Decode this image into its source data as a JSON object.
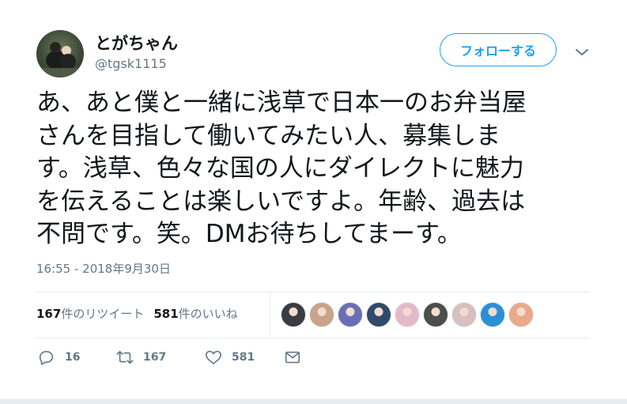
{
  "user": {
    "display_name": "とがちゃん",
    "screen_name": "@tgsk1115",
    "avatar_icon": "user-avatar"
  },
  "follow_button": {
    "label": "フォローする"
  },
  "menu_icon": "chevron-down-icon",
  "tweet": {
    "lines": [
      "あ、あと僕と一緒に浅草で日本一のお弁当屋",
      "さんを目指して働いてみたい人、募集しま",
      "す。浅草、色々な国の人にダイレクトに魅力",
      "を伝えることは楽しいですよ。年齢、過去は",
      "不問です。笑。DMお待ちしてまーす。"
    ],
    "timestamp": "16:55 - 2018年9月30日"
  },
  "stats": {
    "retweets_count": "167",
    "retweets_label": "件のリツイート",
    "likes_count": "581",
    "likes_label": "件のいいね"
  },
  "likers": [
    {
      "name": "liker-1",
      "color": "#3b3b44"
    },
    {
      "name": "liker-2",
      "color": "#c9a48a"
    },
    {
      "name": "liker-3",
      "color": "#6a6fb5"
    },
    {
      "name": "liker-4",
      "color": "#2f4a6b"
    },
    {
      "name": "liker-5",
      "color": "#e3b9c9"
    },
    {
      "name": "liker-6",
      "color": "#4a4f4a"
    },
    {
      "name": "liker-7",
      "color": "#d8c0c0"
    },
    {
      "name": "liker-8",
      "color": "#2b8fd6"
    },
    {
      "name": "liker-9",
      "color": "#e9a98c"
    }
  ],
  "actions": {
    "reply_count": "16",
    "retweet_count": "167",
    "like_count": "581"
  },
  "colors": {
    "accent": "#1da1f2",
    "secondary_text": "#657786",
    "divider": "#e6ecf0"
  }
}
